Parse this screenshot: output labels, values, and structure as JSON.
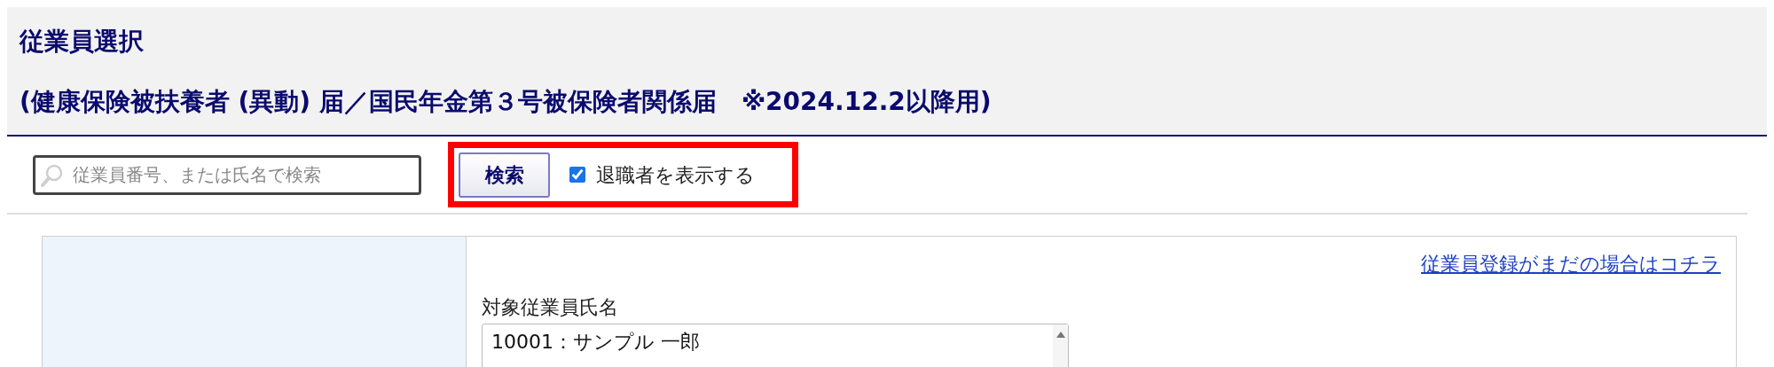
{
  "header": {
    "title": "従業員選択",
    "subtitle": "(健康保険被扶養者 (異動) 届／国民年金第３号被保険者関係届　※2024.12.2以降用)"
  },
  "search": {
    "placeholder": "従業員番号、または氏名で検索"
  },
  "search_button": "検索",
  "show_retired": {
    "label": "退職者を表示する",
    "checked": true
  },
  "register_link": "従業員登録がまだの場合はコチラ",
  "employee_field": {
    "label": "対象従業員氏名",
    "options": [
      {
        "label": "10001：サンプル 一郎",
        "selected": false
      }
    ]
  }
}
